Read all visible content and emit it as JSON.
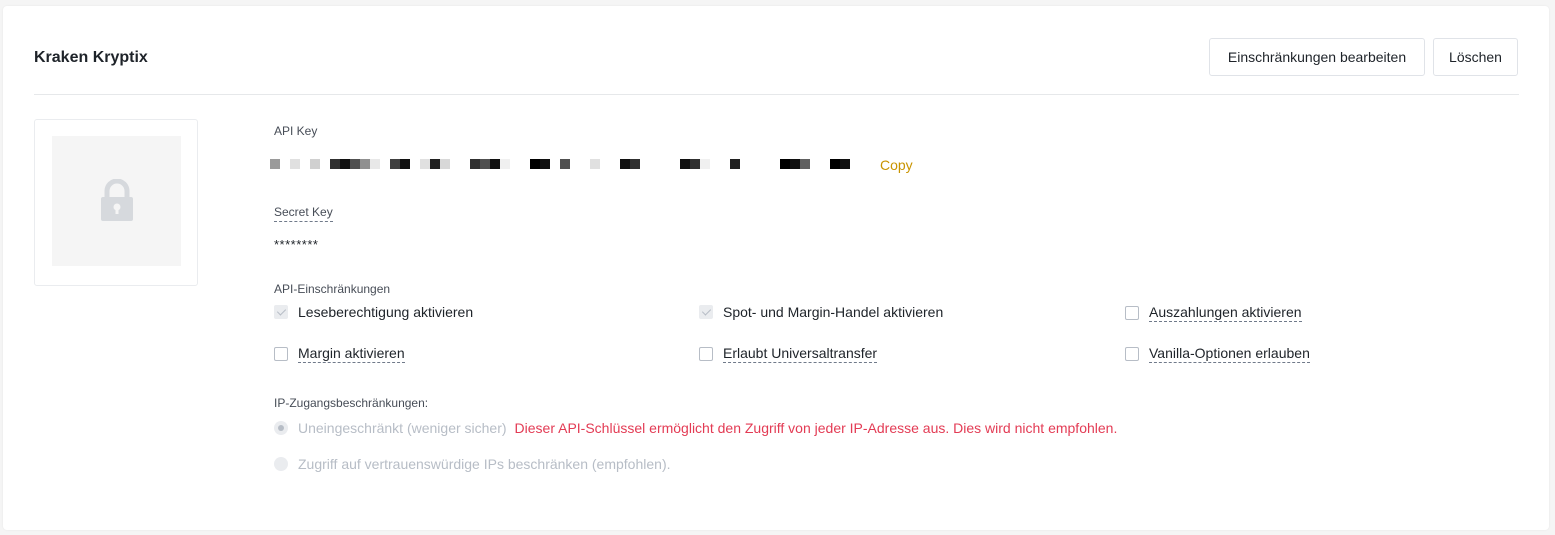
{
  "header": {
    "title": "Kraken Kryptix",
    "edit_button": "Einschränkungen bearbeiten",
    "delete_button": "Löschen"
  },
  "api_key": {
    "label": "API Key",
    "value_redacted": true,
    "copy_label": "Copy"
  },
  "secret_key": {
    "label": "Secret Key",
    "value": "********"
  },
  "restrictions": {
    "label": "API-Einschränkungen",
    "options": [
      {
        "label": "Leseberechtigung aktivieren",
        "checked": true,
        "disabled": true
      },
      {
        "label": "Spot- und Margin-Handel aktivieren",
        "checked": true,
        "disabled": true
      },
      {
        "label": "Auszahlungen aktivieren",
        "checked": false,
        "disabled": false
      },
      {
        "label": "Margin aktivieren",
        "checked": false,
        "disabled": false
      },
      {
        "label": "Erlaubt Universaltransfer",
        "checked": false,
        "disabled": false
      },
      {
        "label": "Vanilla-Optionen erlauben",
        "checked": false,
        "disabled": false
      }
    ]
  },
  "ip_access": {
    "label": "IP-Zugangsbeschränkungen:",
    "options": [
      {
        "label": "Uneingeschränkt (weniger sicher)",
        "selected": true
      },
      {
        "label": "Zugriff auf vertrauenswürdige IPs beschränken (empfohlen).",
        "selected": false
      }
    ],
    "warning": "Dieser API-Schlüssel ermöglicht den Zugriff von jeder IP-Adresse aus. Dies wird nicht empfohlen."
  },
  "colors": {
    "accent": "#c99400",
    "warning": "#e33b54",
    "text": "#1e2329",
    "muted": "#b7bdc6"
  },
  "icons": {
    "thumbnail": "lock-icon"
  }
}
